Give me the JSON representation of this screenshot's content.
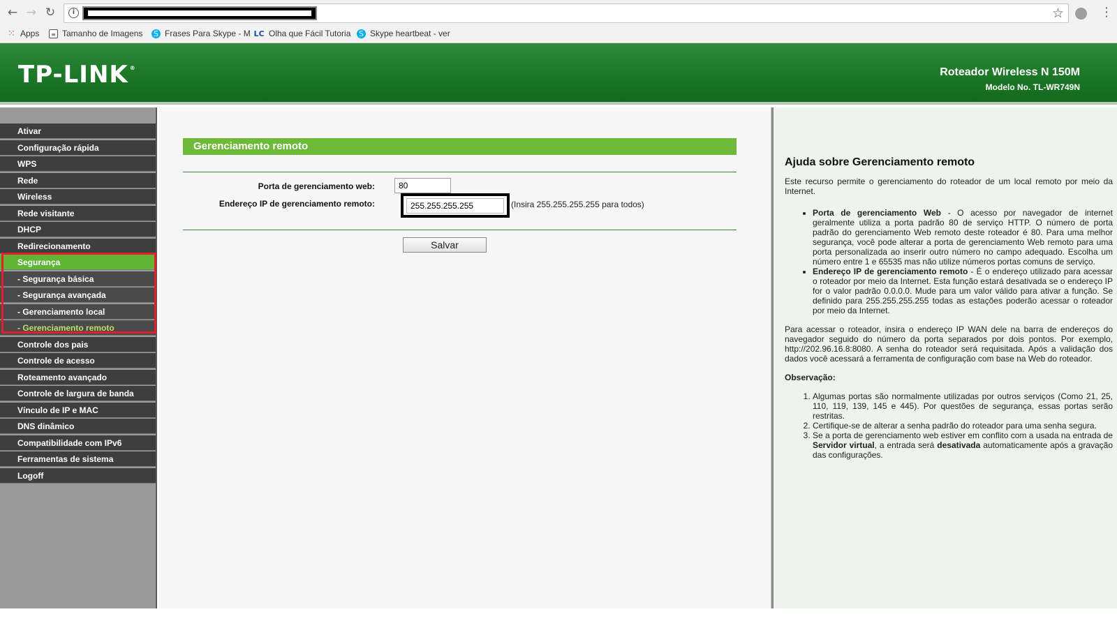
{
  "browser": {
    "bookmarks": [
      {
        "label": "Apps",
        "icon": "apps-grid-icon",
        "color": "#e44d26"
      },
      {
        "label": "Tamanho de Imagens",
        "icon": "page-icon",
        "color": "#3b5998"
      },
      {
        "label": "Frases Para Skype - M",
        "icon": "skype-icon",
        "color": "#00aff0"
      },
      {
        "label": "Olha que Fácil Tutoria",
        "icon": "lc-icon",
        "color": "#1a4fa0"
      },
      {
        "label": "Skype heartbeat - ver",
        "icon": "skype-icon",
        "color": "#00aff0"
      }
    ]
  },
  "header": {
    "logo": "TP-LINK",
    "product": "Roteador Wireless N 150M",
    "model": "Modelo No. TL-WR749N"
  },
  "sidebar": {
    "items": [
      {
        "label": "Ativar",
        "type": "main"
      },
      {
        "label": "Configuração rápida",
        "type": "main"
      },
      {
        "label": "WPS",
        "type": "main"
      },
      {
        "label": "Rede",
        "type": "main"
      },
      {
        "label": "Wireless",
        "type": "main"
      },
      {
        "label": "Rede visitante",
        "type": "main"
      },
      {
        "label": "DHCP",
        "type": "main"
      },
      {
        "label": "Redirecionamento",
        "type": "main"
      },
      {
        "label": "Segurança",
        "type": "active"
      },
      {
        "label": "- Segurança básica",
        "type": "sub"
      },
      {
        "label": "- Segurança avançada",
        "type": "sub"
      },
      {
        "label": "- Gerenciamento local",
        "type": "sub"
      },
      {
        "label": "- Gerenciamento remoto",
        "type": "current"
      },
      {
        "label": "Controle dos pais",
        "type": "main"
      },
      {
        "label": "Controle de acesso",
        "type": "main"
      },
      {
        "label": "Roteamento avançado",
        "type": "main"
      },
      {
        "label": "Controle de largura de banda",
        "type": "main"
      },
      {
        "label": "Vínculo de IP e MAC",
        "type": "main"
      },
      {
        "label": "DNS dinâmico",
        "type": "main"
      },
      {
        "label": "Compatibilidade com IPv6",
        "type": "main"
      },
      {
        "label": "Ferramentas de sistema",
        "type": "main"
      },
      {
        "label": "Logoff",
        "type": "main"
      }
    ]
  },
  "main": {
    "title": "Gerenciamento remoto",
    "port_label": "Porta de gerenciamento web:",
    "port_value": "80",
    "ip_label": "Endereço IP de gerenciamento remoto:",
    "ip_value": "255.255.255.255",
    "ip_hint": "(Insira 255.255.255.255 para todos)",
    "save_label": "Salvar"
  },
  "help": {
    "title": "Ajuda sobre Gerenciamento remoto",
    "intro": "Este recurso permite o gerenciamento do roteador de um local remoto por meio da Internet.",
    "bullets": [
      {
        "term": "Porta de gerenciamento Web",
        "text": " - O acesso por navegador de internet geralmente utiliza a porta padrão 80 de serviço HTTP. O número de porta padrão do gerenciamento Web remoto deste roteador é 80. Para uma melhor segurança, você pode alterar a porta de gerenciamento Web remoto para uma porta personalizada ao inserir outro número no campo adequado. Escolha um número entre 1 e 65535 mas não utilize números portas comuns de serviço."
      },
      {
        "term": "Endereço IP de gerenciamento remoto",
        "text": " - É o endereço utilizado para acessar o roteador por meio da Internet. Esta função estará desativada se o endereço IP for o valor padrão 0.0.0.0. Mude para um valor válido para ativar a função. Se definido para 255.255.255.255 todas as estações poderão acessar o roteador por meio da Internet."
      }
    ],
    "access": "Para acessar o roteador, insira o endereço IP WAN dele na barra de endereços do navegador seguido do número da porta separados por dois pontos. Por exemplo, http://202.96.16.8:8080. A senha do roteador será requisitada. Após a validação dos dados você acessará a ferramenta de configuração com base na Web do roteador.",
    "obs_title": "Observação:",
    "notes": {
      "n1": "Algumas portas são normalmente utilizadas por outros serviços (Como 21, 25, 110, 119, 139, 145 e 445). Por questões de segurança, essas portas serão restritas.",
      "n2": "Certifique-se de alterar a senha padrão do roteador para uma senha segura.",
      "n3_a": "Se a porta de gerenciamento web estiver em conflito com a usada na entrada de ",
      "n3_b": "Servidor virtual",
      "n3_c": ", a entrada será ",
      "n3_d": "desativada",
      "n3_e": " automaticamente após a gravação das configurações."
    }
  },
  "colors": {
    "header_green": "#1f7a2a",
    "active_green": "#5fb534",
    "current_text": "#b6e36b",
    "highlight_red": "#e2202a"
  }
}
